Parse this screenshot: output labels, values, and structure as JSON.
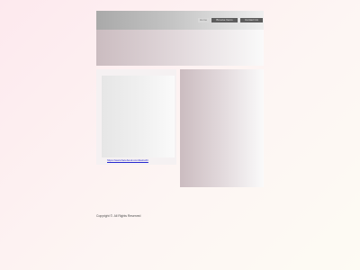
{
  "header": {
    "nav": [
      {
        "label": "Home"
      },
      {
        "label": "Browse Items"
      },
      {
        "label": "Contact Us"
      }
    ]
  },
  "social": {
    "facebook_link": "https://www.facebook.com/kazuchi"
  },
  "footer": {
    "copyright": "Copyright ©. All Rights Reserved"
  }
}
